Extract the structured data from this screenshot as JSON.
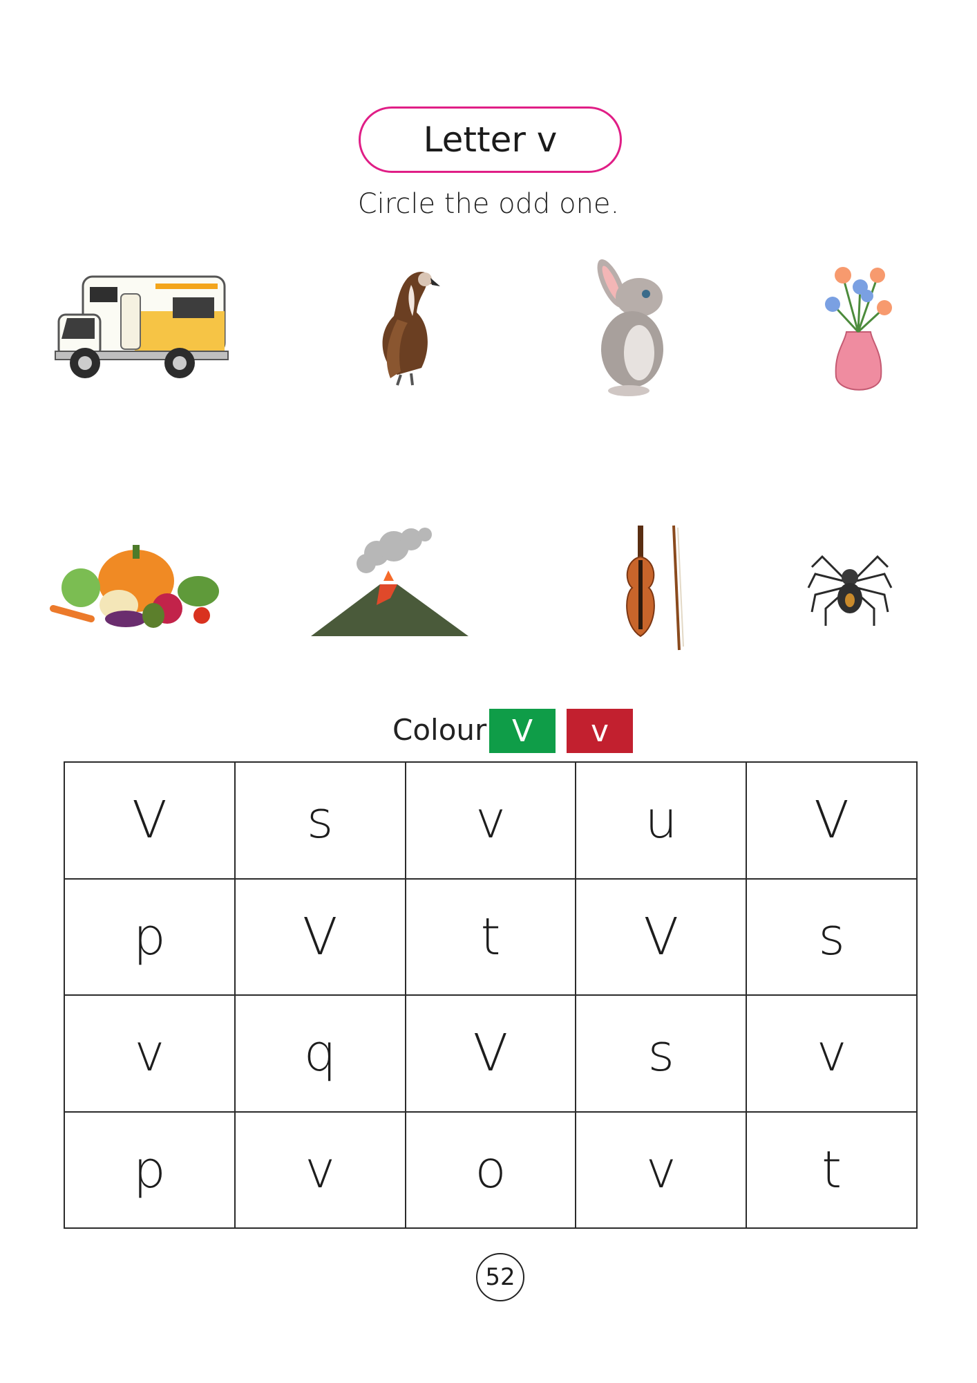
{
  "title": "Letter v",
  "instruction": "Circle the odd one.",
  "pictures": [
    {
      "name": "camper-van"
    },
    {
      "name": "vulture"
    },
    {
      "name": "rabbit"
    },
    {
      "name": "vase"
    },
    {
      "name": "vegetables"
    },
    {
      "name": "volcano"
    },
    {
      "name": "violin"
    },
    {
      "name": "spider"
    }
  ],
  "colour_task": {
    "label": "Colour",
    "swatches": [
      {
        "letter": "V",
        "color": "#0f9d48"
      },
      {
        "letter": "v",
        "color": "#c2202f"
      }
    ]
  },
  "letter_grid": [
    [
      "V",
      "s",
      "v",
      "u",
      "V"
    ],
    [
      "p",
      "V",
      "t",
      "V",
      "s"
    ],
    [
      "v",
      "q",
      "V",
      "s",
      "v"
    ],
    [
      "p",
      "v",
      "o",
      "v",
      "t"
    ]
  ],
  "page_number": "52"
}
